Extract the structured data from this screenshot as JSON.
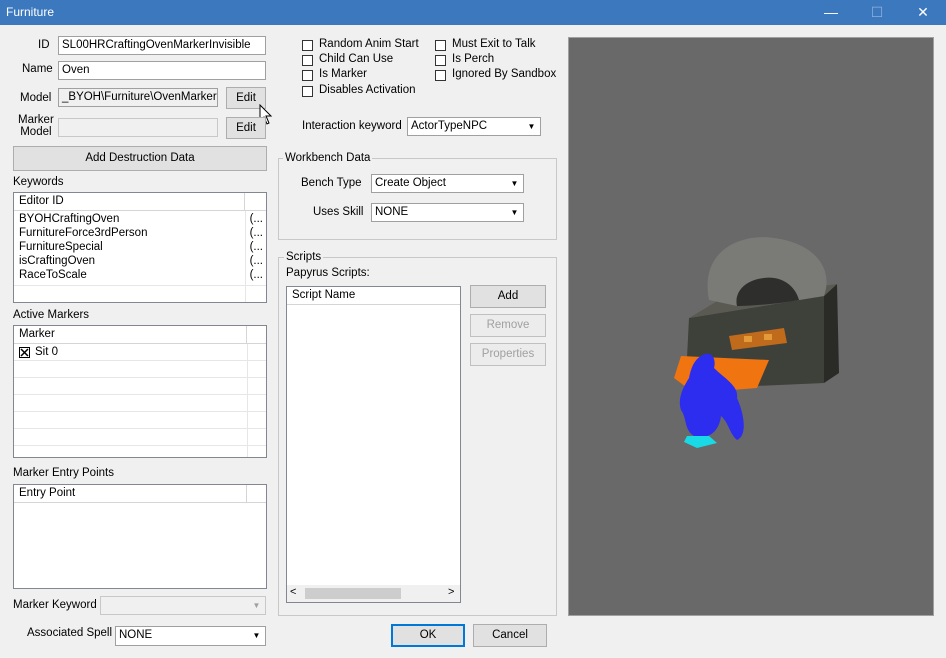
{
  "window": {
    "title": "Furniture",
    "minimize": "—",
    "maximize": "☐",
    "close": "✕"
  },
  "left": {
    "id_label": "ID",
    "id_value": "SL00HRCraftingOvenMarkerInvisible",
    "name_label": "Name",
    "name_value": "Oven",
    "model_label": "Model",
    "model_value": "_BYOH\\Furniture\\OvenMarker.n",
    "model_edit": "Edit",
    "marker_model_label_1": "Marker",
    "marker_model_label_2": "Model",
    "marker_model_value": "",
    "marker_edit": "Edit",
    "add_destruction": "Add Destruction Data",
    "keywords_label": "Keywords",
    "keywords_header": "Editor ID",
    "keywords": [
      {
        "name": "BYOHCraftingOven",
        "extra": "(..."
      },
      {
        "name": "FurnitureForce3rdPerson",
        "extra": "(..."
      },
      {
        "name": "FurnitureSpecial",
        "extra": "(..."
      },
      {
        "name": "isCraftingOven",
        "extra": "(..."
      },
      {
        "name": "RaceToScale",
        "extra": "(..."
      }
    ],
    "active_markers_label": "Active Markers",
    "markers_header": "Marker",
    "markers": [
      {
        "name": "Sit 0",
        "checked": true
      }
    ],
    "entry_points_label": "Marker Entry Points",
    "entry_header": "Entry Point",
    "marker_keyword_label": "Marker Keyword",
    "marker_keyword_value": "",
    "assoc_spell_label": "Associated Spell",
    "assoc_spell_value": "NONE"
  },
  "flags": {
    "random_anim_start": {
      "label": "Random Anim Start",
      "checked": false
    },
    "child_can_use": {
      "label": "Child Can Use",
      "checked": false
    },
    "is_marker": {
      "label": "Is Marker",
      "checked": false
    },
    "disables_activation": {
      "label": "Disables Activation",
      "checked": false
    },
    "must_exit_to_talk": {
      "label": "Must Exit to Talk",
      "checked": false
    },
    "is_perch": {
      "label": "Is Perch",
      "checked": false
    },
    "ignored_by_sandbox": {
      "label": "Ignored By Sandbox",
      "checked": false
    }
  },
  "interaction": {
    "label": "Interaction keyword",
    "value": "ActorTypeNPC"
  },
  "workbench": {
    "title": "Workbench Data",
    "bench_type_label": "Bench Type",
    "bench_type_value": "Create Object",
    "uses_skill_label": "Uses Skill",
    "uses_skill_value": "NONE"
  },
  "scripts": {
    "title": "Scripts",
    "papyrus_label": "Papyrus Scripts:",
    "header": "Script Name",
    "add": "Add",
    "remove": "Remove",
    "properties": "Properties"
  },
  "buttons": {
    "ok": "OK",
    "cancel": "Cancel"
  },
  "colors": {
    "titlebar": "#3c78be",
    "preview_bg": "#696969"
  }
}
